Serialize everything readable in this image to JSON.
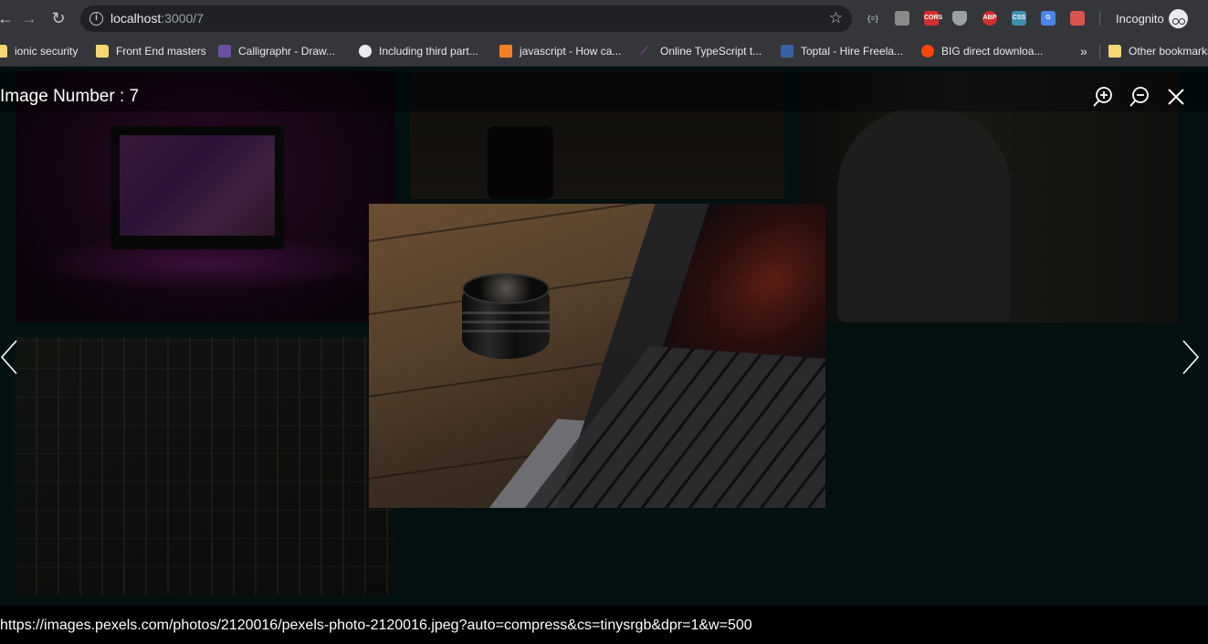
{
  "browser": {
    "url_host": "localhost",
    "url_path": ":3000/7",
    "profile_label": "Incognito",
    "bookmarks": [
      {
        "label": "ionic security"
      },
      {
        "label": "Front End masters"
      },
      {
        "label": "Calligraphr - Draw..."
      },
      {
        "label": "Including third part..."
      },
      {
        "label": "javascript - How ca..."
      },
      {
        "label": "Online TypeScript t..."
      },
      {
        "label": "Toptal - Hire Freela..."
      },
      {
        "label": "BIG direct downloa..."
      }
    ],
    "overflow_label": "»",
    "other_bookmarks_label": "Other bookmarks",
    "extensions": [
      {
        "name": "json-viewer-icon",
        "label": "{≡}",
        "color": "#35363a"
      },
      {
        "name": "tab-extension-icon",
        "label": "",
        "color": "#8a8a8a"
      },
      {
        "name": "cors-extension-icon",
        "label": "CORS",
        "color": "#d32f2f"
      },
      {
        "name": "shield-extension-icon",
        "label": "",
        "color": "#9aa0a6"
      },
      {
        "name": "adblock-plus-icon",
        "label": "ABP",
        "color": "#d32f2f"
      },
      {
        "name": "css-peeper-icon",
        "label": "CSS",
        "color": "#3c8fb0"
      },
      {
        "name": "google-translate-icon",
        "label": "G",
        "color": "#4a86e8"
      },
      {
        "name": "screenshot-extension-icon",
        "label": "",
        "color": "#d9534f"
      }
    ]
  },
  "lightbox": {
    "title": "Image Number : 7",
    "zoom_in_label": "zoom in",
    "zoom_out_label": "zoom out",
    "close_label": "close"
  },
  "status": {
    "url": "https://images.pexels.com/photos/2120016/pexels-photo-2120016.jpeg?auto=compress&cs=tinysrgb&dpr=1&w=500"
  }
}
